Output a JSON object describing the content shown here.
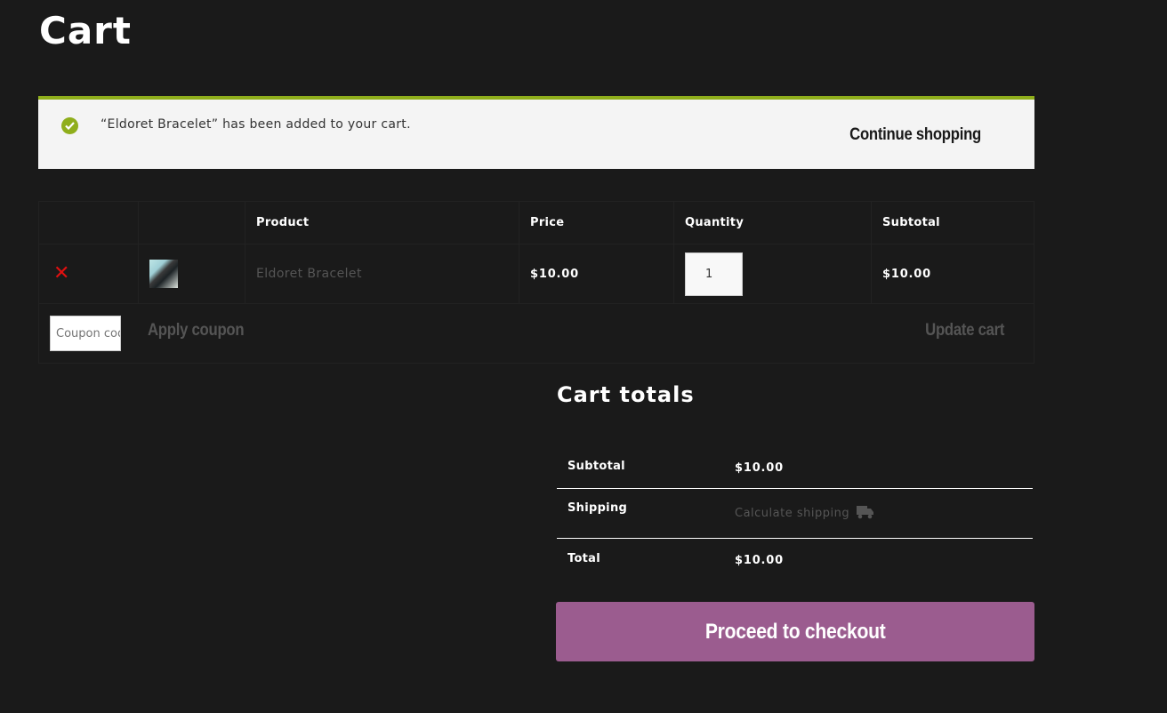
{
  "page": {
    "title": "Cart"
  },
  "notice": {
    "message": "“Eldoret Bracelet” has been added to your cart.",
    "link_label": "Continue shopping",
    "accent_color": "#8fae1b"
  },
  "cart_table": {
    "headers": [
      "",
      "",
      "Product",
      "Price",
      "Quantity",
      "Subtotal"
    ],
    "rows": [
      {
        "remove_icon": "remove-x-icon",
        "product": "Eldoret Bracelet",
        "price": "$10.00",
        "quantity": "1",
        "subtotal": "$10.00"
      }
    ]
  },
  "actions": {
    "coupon_placeholder": "Coupon code",
    "apply_label": "Apply coupon",
    "update_label": "Update cart"
  },
  "totals": {
    "title": "Cart totals",
    "subtotal_label": "Subtotal",
    "subtotal_value": "$10.00",
    "shipping_label": "Shipping",
    "shipping_link": "Calculate shipping",
    "total_label": "Total",
    "total_value": "$10.00"
  },
  "checkout": {
    "label": "Proceed to checkout",
    "color": "#9b5c8f"
  }
}
